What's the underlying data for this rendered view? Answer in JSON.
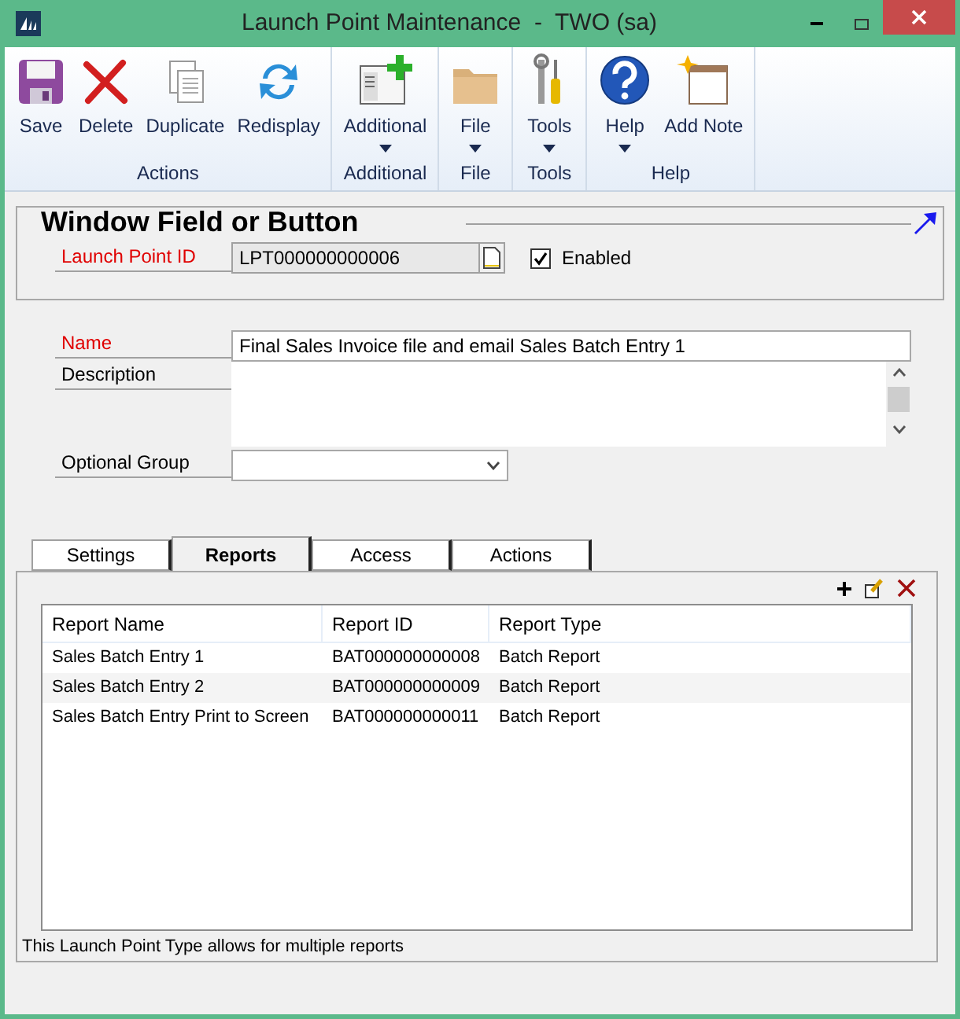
{
  "window": {
    "title": "Launch Point Maintenance  -  TWO (sa)"
  },
  "ribbon": {
    "groups": [
      {
        "label": "Actions",
        "buttons": [
          {
            "label": "Save",
            "has_menu": false
          },
          {
            "label": "Delete",
            "has_menu": false
          },
          {
            "label": "Duplicate",
            "has_menu": false
          },
          {
            "label": "Redisplay",
            "has_menu": false
          }
        ]
      },
      {
        "label": "Additional",
        "buttons": [
          {
            "label": "Additional",
            "has_menu": true
          }
        ]
      },
      {
        "label": "File",
        "buttons": [
          {
            "label": "File",
            "has_menu": true
          }
        ]
      },
      {
        "label": "Tools",
        "buttons": [
          {
            "label": "Tools",
            "has_menu": true
          }
        ]
      },
      {
        "label": "Help",
        "buttons": [
          {
            "label": "Help",
            "has_menu": true
          },
          {
            "label": "Add Note",
            "has_menu": false
          }
        ]
      }
    ]
  },
  "header": {
    "title": "Window Field or Button",
    "launch_point_id": {
      "label": "Launch Point  ID",
      "value": "LPT000000000006",
      "required": true
    },
    "enabled": {
      "label": "Enabled",
      "checked": true
    }
  },
  "fields": {
    "name": {
      "label": "Name",
      "value": "Final Sales Invoice file and email Sales Batch Entry 1",
      "required": true
    },
    "description": {
      "label": "Description",
      "required": false
    },
    "optional_group": {
      "label": "Optional Group",
      "required": false
    }
  },
  "tabs": [
    {
      "label": "Settings",
      "selected": false
    },
    {
      "label": "Reports",
      "selected": true
    },
    {
      "label": "Access",
      "selected": false
    },
    {
      "label": "Actions",
      "selected": false
    }
  ],
  "table": {
    "columns": [
      "Report Name",
      "Report ID",
      "Report Type"
    ],
    "rows": [
      [
        "Sales Batch Entry 1",
        "BAT000000000008",
        "Batch Report"
      ],
      [
        "Sales Batch Entry 2",
        "BAT000000000009",
        "Batch Report"
      ],
      [
        "Sales Batch Entry Print to Screen",
        "BAT000000000011",
        "Batch Report"
      ]
    ]
  },
  "footer_note": "This Launch Point Type allows for multiple reports"
}
